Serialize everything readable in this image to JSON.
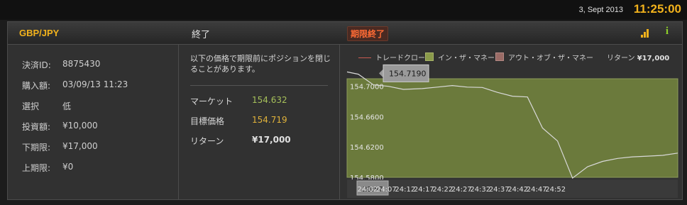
{
  "header": {
    "date": "3, Sept 2013",
    "time": "11:25:00"
  },
  "trade": {
    "pair": "GBP/JPY",
    "status": "終了",
    "expired_badge": "期限終了",
    "icons": [
      "signal-bars-icon",
      "info-icon"
    ],
    "details": [
      {
        "label": "決済ID:",
        "value": "8875430"
      },
      {
        "label": "購入額:",
        "value": "03/09/13 11:23"
      },
      {
        "label": "選択",
        "value": "低"
      },
      {
        "label": "投資額:",
        "value": "¥10,000"
      },
      {
        "label": "下期限:",
        "value": "¥17,000"
      },
      {
        "label": "上期限:",
        "value": "¥0"
      }
    ],
    "note": "以下の価格で期限前にポジションを閉じることがあります。",
    "market_label": "マーケット",
    "market_value": "154.632",
    "target_label": "目標価格",
    "target_value": "154.719",
    "return_label": "リターン",
    "return_value": "¥17,000"
  },
  "legend": {
    "trade_close": "トレードクローズ",
    "in_the_money": "イン・ザ・マネー",
    "out_of_money": "アウト・オブ・ザ・マネー",
    "return_label": "リターン",
    "return_value": "¥17,000"
  },
  "colors": {
    "accent": "#f2b21c",
    "market": "#a6c05a",
    "target": "#e0b23a",
    "chart_bg": "#6b7a3c",
    "in_swatch": "#8a9a4a",
    "out_swatch": "#9a6b66"
  },
  "chart_data": {
    "type": "line",
    "x": [
      "24:02",
      "24:07",
      "24:12",
      "24:17",
      "24:22",
      "24:27",
      "24:32",
      "24:37",
      "24:42",
      "24:47",
      "24:52"
    ],
    "x_start_label": "23:57",
    "ylim": [
      154.58,
      154.71
    ],
    "yticks": [
      "154.7000",
      "154.6600",
      "154.6200",
      "154.5800"
    ],
    "tooltip": "154.7190",
    "series": [
      {
        "values": [
          [
            23.57,
            154.719
          ],
          [
            24.0,
            154.716
          ],
          [
            24.04,
            154.702
          ],
          [
            24.08,
            154.7
          ],
          [
            24.12,
            154.696
          ],
          [
            24.17,
            154.697
          ],
          [
            24.21,
            154.699
          ],
          [
            24.25,
            154.701
          ],
          [
            24.29,
            154.699
          ],
          [
            24.33,
            154.6985
          ],
          [
            24.37,
            154.692
          ],
          [
            24.41,
            154.687
          ],
          [
            24.45,
            154.686
          ],
          [
            24.49,
            154.645
          ],
          [
            24.53,
            154.628
          ],
          [
            24.57,
            154.579
          ],
          [
            25.01,
            154.594
          ],
          [
            25.05,
            154.601
          ],
          [
            25.09,
            154.605
          ],
          [
            25.13,
            154.607
          ],
          [
            25.17,
            154.608
          ],
          [
            25.21,
            154.609
          ],
          [
            25.25,
            154.612
          ]
        ]
      }
    ],
    "grid": false,
    "legend_position": "top"
  }
}
